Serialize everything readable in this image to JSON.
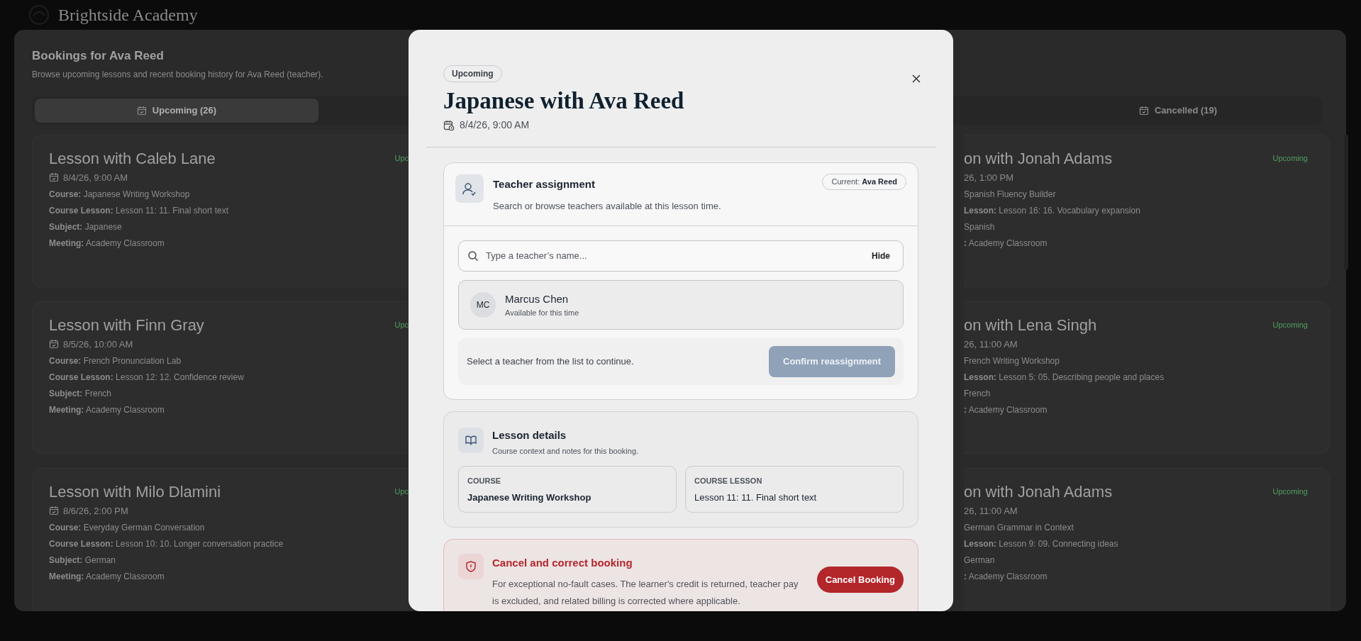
{
  "app": {
    "brand": "Brightside Academy"
  },
  "page": {
    "title": "Bookings for Ava Reed",
    "subtitle": "Browse upcoming lessons and recent booking history for Ava Reed (teacher)."
  },
  "tabs": [
    {
      "label": "Upcoming (26)",
      "selected": true
    },
    {
      "label": "Cancelled (19)",
      "selected": false
    }
  ],
  "left_cards": [
    {
      "title": "Lesson with Caleb Lane",
      "date": "8/4/26, 9:00 AM",
      "status": "Upc",
      "fields": [
        {
          "label": "Course:",
          "value": "Japanese Writing Workshop"
        },
        {
          "label": "Course Lesson:",
          "value": "Lesson 11: 11. Final short text"
        },
        {
          "label": "Subject:",
          "value": "Japanese"
        },
        {
          "label": "Meeting:",
          "value": "Academy Classroom"
        }
      ]
    },
    {
      "title": "Lesson with Finn Gray",
      "date": "8/5/26, 10:00 AM",
      "status": "Upc",
      "fields": [
        {
          "label": "Course:",
          "value": "French Pronunciation Lab"
        },
        {
          "label": "Course Lesson:",
          "value": "Lesson 12: 12. Confidence review"
        },
        {
          "label": "Subject:",
          "value": "French"
        },
        {
          "label": "Meeting:",
          "value": "Academy Classroom"
        }
      ]
    },
    {
      "title": "Lesson with Milo Dlamini",
      "date": "8/6/26, 2:00 PM",
      "status": "Upc",
      "fields": [
        {
          "label": "Course:",
          "value": "Everyday German Conversation"
        },
        {
          "label": "Course Lesson:",
          "value": "Lesson 10: 10. Longer conversation practice"
        },
        {
          "label": "Subject:",
          "value": "German"
        },
        {
          "label": "Meeting:",
          "value": "Academy Classroom"
        }
      ]
    }
  ],
  "right_cards": [
    {
      "title": "on with Jonah Adams",
      "date": "26, 1:00 PM",
      "status": "Upcoming",
      "fields": [
        {
          "value": "Spanish Fluency Builder"
        },
        {
          "label": "Lesson:",
          "value": "Lesson 16: 16. Vocabulary expansion"
        },
        {
          "value": "Spanish"
        },
        {
          "label": ":",
          "value": "Academy Classroom"
        }
      ]
    },
    {
      "title": "on with Lena Singh",
      "date": "26, 11:00 AM",
      "status": "Upcoming",
      "fields": [
        {
          "value": "French Writing Workshop"
        },
        {
          "label": "Lesson:",
          "value": "Lesson 5: 05. Describing people and places"
        },
        {
          "value": "French"
        },
        {
          "label": ":",
          "value": "Academy Classroom"
        }
      ]
    },
    {
      "title": "on with Jonah Adams",
      "date": "26, 11:00 AM",
      "status": "Upcoming",
      "fields": [
        {
          "value": "German Grammar in Context"
        },
        {
          "label": "Lesson:",
          "value": "Lesson 9: 09. Connecting ideas"
        },
        {
          "value": "German"
        },
        {
          "label": ":",
          "value": "Academy Classroom"
        }
      ]
    }
  ],
  "modal": {
    "status": "Upcoming",
    "title": "Japanese with Ava Reed",
    "date": "8/4/26, 9:00 AM",
    "teacher_assignment": {
      "title": "Teacher assignment",
      "subtitle": "Search or browse teachers available at this lesson time.",
      "current_label": "Current:",
      "current_name": "Ava Reed",
      "search_placeholder": "Type a teacher’s name...",
      "hide": "Hide",
      "results": [
        {
          "initials": "MC",
          "name": "Marcus Chen",
          "note": "Available for this time",
          "selected": false
        }
      ],
      "hint": "Select a teacher from the list to continue.",
      "confirm": {
        "label": "Confirm reassignment",
        "disabled": true
      }
    },
    "lesson_details": {
      "title": "Lesson details",
      "subtitle": "Course context and notes for this booking.",
      "fields": [
        {
          "label": "COURSE",
          "value": "Japanese Writing Workshop",
          "strong": true
        },
        {
          "label": "COURSE LESSON",
          "value": "Lesson 11: 11. Final short text",
          "strong": false
        }
      ]
    },
    "cancel": {
      "title": "Cancel and correct booking",
      "text": "For exceptional no-fault cases. The learner's credit is returned, teacher pay is excluded, and related billing is corrected where applicable.",
      "button": "Cancel Booking"
    }
  }
}
